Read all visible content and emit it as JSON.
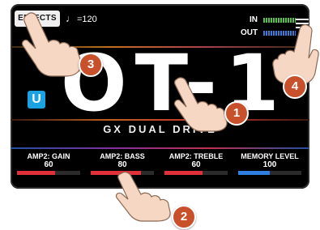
{
  "header": {
    "effects_label": "EFFECTS",
    "tempo_icon": "♩",
    "tempo_text": "=120",
    "in_label": "IN",
    "out_label": "OUT"
  },
  "logo": {
    "badge": "U",
    "title": "OT-1",
    "subtitle": "GX DUAL DRIVE"
  },
  "params": [
    {
      "name": "AMP2: GAIN",
      "value": "60",
      "level": 0.6,
      "color": "#e0303a"
    },
    {
      "name": "AMP2: BASS",
      "value": "80",
      "level": 0.8,
      "color": "#e0303a"
    },
    {
      "name": "AMP2: TREBLE",
      "value": "60",
      "level": 0.6,
      "color": "#e0303a"
    },
    {
      "name": "MEMORY LEVEL",
      "value": "100",
      "level": 0.5,
      "color": "#2f7fe0"
    }
  ],
  "callouts": [
    "1",
    "2",
    "3",
    "4"
  ]
}
